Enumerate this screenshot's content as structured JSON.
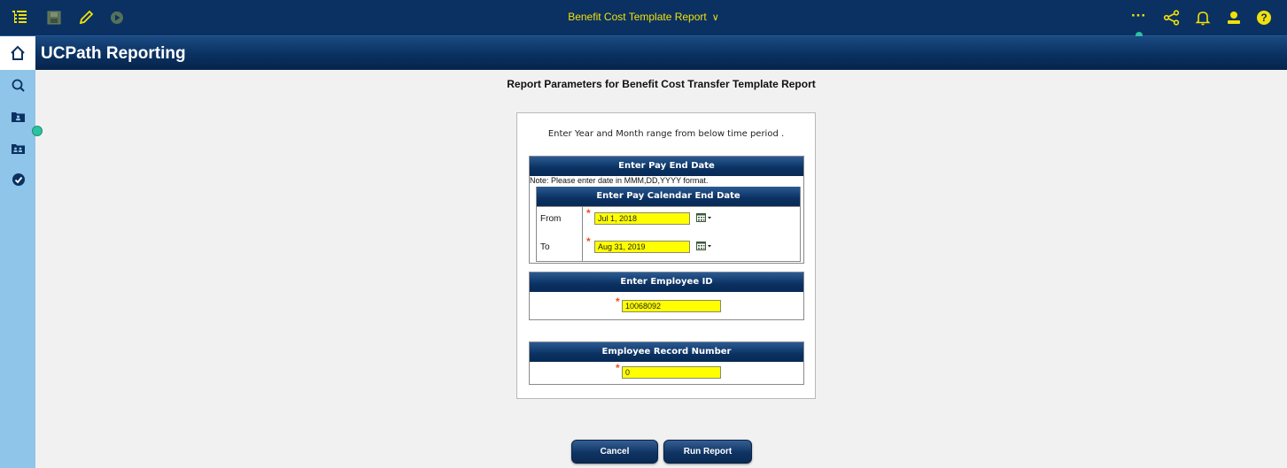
{
  "topbar": {
    "report_title": "Benefit Cost Template Report",
    "title_caret": "∨",
    "left_icons": [
      "outline-icon",
      "save-icon",
      "edit-pencil-icon",
      "run-play-icon"
    ],
    "right_icons": [
      "more-dots-icon",
      "share-icon",
      "bell-icon",
      "user-icon",
      "help-icon"
    ],
    "more_label": "···",
    "help_label": "?",
    "accent_color": "#f2e00a"
  },
  "header": {
    "title": "UCPath Reporting"
  },
  "sidebar": {
    "icons": [
      "search-icon",
      "folder-person-icon",
      "folder-group-icon",
      "check-circle-icon"
    ]
  },
  "main": {
    "title": "Report Parameters for Benefit Cost Transfer Template Report",
    "instruction": "Enter Year and Month range from below time period .",
    "pay_end": {
      "header": "Enter Pay End Date",
      "note": "Note:  Please enter date in MMM,DD,YYYY format.",
      "calendar_header": "Enter Pay Calendar End Date",
      "from_label": "From",
      "from_value": "Jul 1, 2018",
      "to_label": "To",
      "to_value": "Aug 31, 2019"
    },
    "employee_id": {
      "header": "Enter Employee ID",
      "value": "10068092"
    },
    "record_number": {
      "header": "Employee Record Number",
      "value": "0"
    },
    "required_marker": "*"
  },
  "buttons": {
    "cancel": "Cancel",
    "run": "Run Report"
  }
}
